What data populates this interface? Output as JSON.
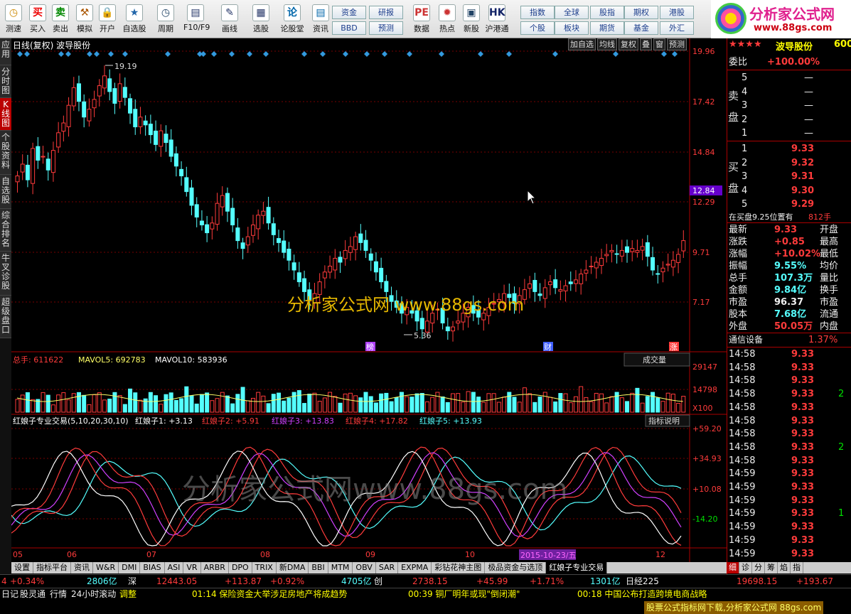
{
  "toolbar": {
    "buttons": [
      {
        "label": "测速",
        "icon": "clock-icon"
      },
      {
        "label": "买入",
        "icon": "buy-icon"
      },
      {
        "label": "卖出",
        "icon": "sell-icon"
      },
      {
        "label": "模拟",
        "icon": "hammer-icon"
      },
      {
        "label": "开户",
        "icon": "lock-icon"
      },
      {
        "label": "自选股",
        "icon": "star-icon"
      },
      {
        "label": "周期",
        "icon": "clock-icon"
      },
      {
        "label": "F10/F9",
        "icon": "doc-icon"
      },
      {
        "label": "画线",
        "icon": "pen-icon"
      },
      {
        "label": "选股",
        "icon": "screen-icon"
      },
      {
        "label": "论股堂",
        "icon": "chat-icon"
      },
      {
        "label": "资讯",
        "icon": "news-icon"
      },
      {
        "label": "数据",
        "icon": "data-icon"
      },
      {
        "label": "热点",
        "icon": "hot-icon"
      },
      {
        "label": "新股",
        "icon": "newstock-icon"
      },
      {
        "label": "沪港通",
        "icon": "hk-icon"
      }
    ],
    "small": [
      "资金",
      "研报",
      "BBD",
      "预测",
      "指数",
      "全球",
      "股指",
      "期权",
      "港股",
      "个股",
      "板块",
      "期货",
      "基金",
      "外汇"
    ]
  },
  "logo": {
    "title": "分析家公式网",
    "url": "www.88gs.com"
  },
  "lefttabs": [
    "应用",
    "分时图",
    "K线图",
    "个股资料",
    "自选股",
    "综合排名",
    "牛叉诊股",
    "超级盘口"
  ],
  "chart": {
    "title": "日线(复权) 波导股份",
    "top_buttons": [
      "加自选",
      "均线",
      "复权",
      "叠",
      "窗",
      "预测"
    ],
    "high_label": "19.19",
    "low_label": "5.36",
    "price_ticks": [
      "19.96",
      "17.42",
      "14.84",
      "12.29",
      "9.71",
      "7.17"
    ],
    "current_price_tag": "12.84",
    "watermark": "分析家公式网  www.88gs.com",
    "watermark2": "分析家公式网www.88gs.com",
    "markers": [
      "榜",
      "财",
      "涨"
    ],
    "vol_title": {
      "label": "总手: 611622",
      "ma5": "MAVOL5: 692783",
      "ma10": "MAVOL10: 583936"
    },
    "vol_dropdown": "成交量",
    "vol_ticks": [
      "29147",
      "14798",
      "X100"
    ],
    "ind_title": {
      "name": "红娘子专业交易(5,10,20,30,10)",
      "l1": "红娘子1: +3.13",
      "l2": "红娘子2: +5.91",
      "l3": "红娘子3: +13.83",
      "l4": "红娘子4: +17.82",
      "l5": "红娘子5: +13.93"
    },
    "ind_button": "指标说明",
    "ind_ticks": [
      "+59.20",
      "+34.93",
      "+10.08",
      "-14.20"
    ],
    "months": [
      "05",
      "06",
      "07",
      "08",
      "09",
      "10",
      "12"
    ],
    "cursor_date": "2015-10-23/五"
  },
  "quote": {
    "name": "波导股份",
    "code": "600",
    "stars": "★★★★",
    "weibi_label": "委比",
    "weibi": "+100.00%",
    "sell_label": "卖盘",
    "buy_label": "买盘",
    "sell": [
      {
        "n": "5",
        "p": "—"
      },
      {
        "n": "4",
        "p": "—"
      },
      {
        "n": "3",
        "p": "—"
      },
      {
        "n": "2",
        "p": "—"
      },
      {
        "n": "1",
        "p": "—"
      }
    ],
    "buy": [
      {
        "n": "1",
        "p": "9.33"
      },
      {
        "n": "2",
        "p": "9.32"
      },
      {
        "n": "3",
        "p": "9.31"
      },
      {
        "n": "4",
        "p": "9.30"
      },
      {
        "n": "5",
        "p": "9.29"
      }
    ],
    "note": "在买盘9.25位置有",
    "note_v": "812手",
    "stats": [
      {
        "k": "最新",
        "v": "9.33",
        "k2": "开盘"
      },
      {
        "k": "涨跌",
        "v": "+0.85",
        "k2": "最高"
      },
      {
        "k": "涨幅",
        "v": "+10.02%",
        "k2": "最低"
      },
      {
        "k": "振幅",
        "v": "9.55%",
        "k2": "均价"
      },
      {
        "k": "总手",
        "v": "107.3万",
        "k2": "量比"
      },
      {
        "k": "金额",
        "v": "9.84亿",
        "k2": "换手"
      },
      {
        "k": "市盈",
        "v": "96.37",
        "k2": "市盈"
      },
      {
        "k": "股本",
        "v": "7.68亿",
        "k2": "流通"
      },
      {
        "k": "外盘",
        "v": "50.05万",
        "k2": "内盘"
      }
    ],
    "sector": "通信设备",
    "sector_v": "1.37%",
    "ticks": [
      {
        "t": "14:58",
        "p": "9.33"
      },
      {
        "t": "14:58",
        "p": "9.33"
      },
      {
        "t": "14:58",
        "p": "9.33"
      },
      {
        "t": "14:58",
        "p": "9.33"
      },
      {
        "t": "14:58",
        "p": "9.33"
      },
      {
        "t": "14:58",
        "p": "9.33"
      },
      {
        "t": "14:58",
        "p": "9.33"
      },
      {
        "t": "14:58",
        "p": "9.33"
      },
      {
        "t": "14:58",
        "p": "9.33"
      },
      {
        "t": "14:59",
        "p": "9.33"
      },
      {
        "t": "14:59",
        "p": "9.33"
      },
      {
        "t": "14:59",
        "p": "9.33"
      },
      {
        "t": "14:59",
        "p": "9.33"
      },
      {
        "t": "14:59",
        "p": "9.33"
      },
      {
        "t": "14:59",
        "p": "9.33"
      },
      {
        "t": "14:59",
        "p": "9.33"
      },
      {
        "t": "14:59",
        "p": "9.33"
      }
    ],
    "tick_vols": [
      "",
      "",
      "",
      "2",
      "",
      "",
      "",
      "2",
      "",
      "",
      "",
      "",
      "1",
      "",
      "",
      "",
      ""
    ]
  },
  "bottom_tabs": [
    "设置",
    "指标平台",
    "资讯",
    "W&R",
    "DMI",
    "BIAS",
    "ASI",
    "VR",
    "ARBR",
    "DPO",
    "TRIX",
    "新DMA",
    "BBI",
    "MTM",
    "OBV",
    "SAR",
    "EXPMA",
    "彩钻花神主图",
    "极品资金与选顶",
    "红娘子专业交易"
  ],
  "right_tabs": [
    "细",
    "诊",
    "分",
    "筹",
    "焰",
    "指"
  ],
  "status1": {
    "a": "4",
    "b": "+0.34%",
    "c": "2806亿",
    "d": "深",
    "e": "12443.05",
    "f": "+113.87",
    "g": "+0.92%",
    "h": "4705亿",
    "i": "创",
    "j": "2738.15",
    "k": "+45.99",
    "l": "+1.71%",
    "m": "1301亿",
    "n": "日经225",
    "o": "19698.15",
    "p": "+193.67"
  },
  "status2": {
    "a": "日记",
    "b": "股灵通",
    "c": "行情",
    "d": "24小时滚动",
    "e": "调整",
    "f": "01:14 保险资金大举涉足房地产将成趋势",
    "g": "00:39 铜厂明年或现\"倒闭潮\"",
    "h": "00:18 中国公布打造跨境电商战略",
    "i": "股票公式指标网下载,分析家公式网 88gs.com"
  }
}
